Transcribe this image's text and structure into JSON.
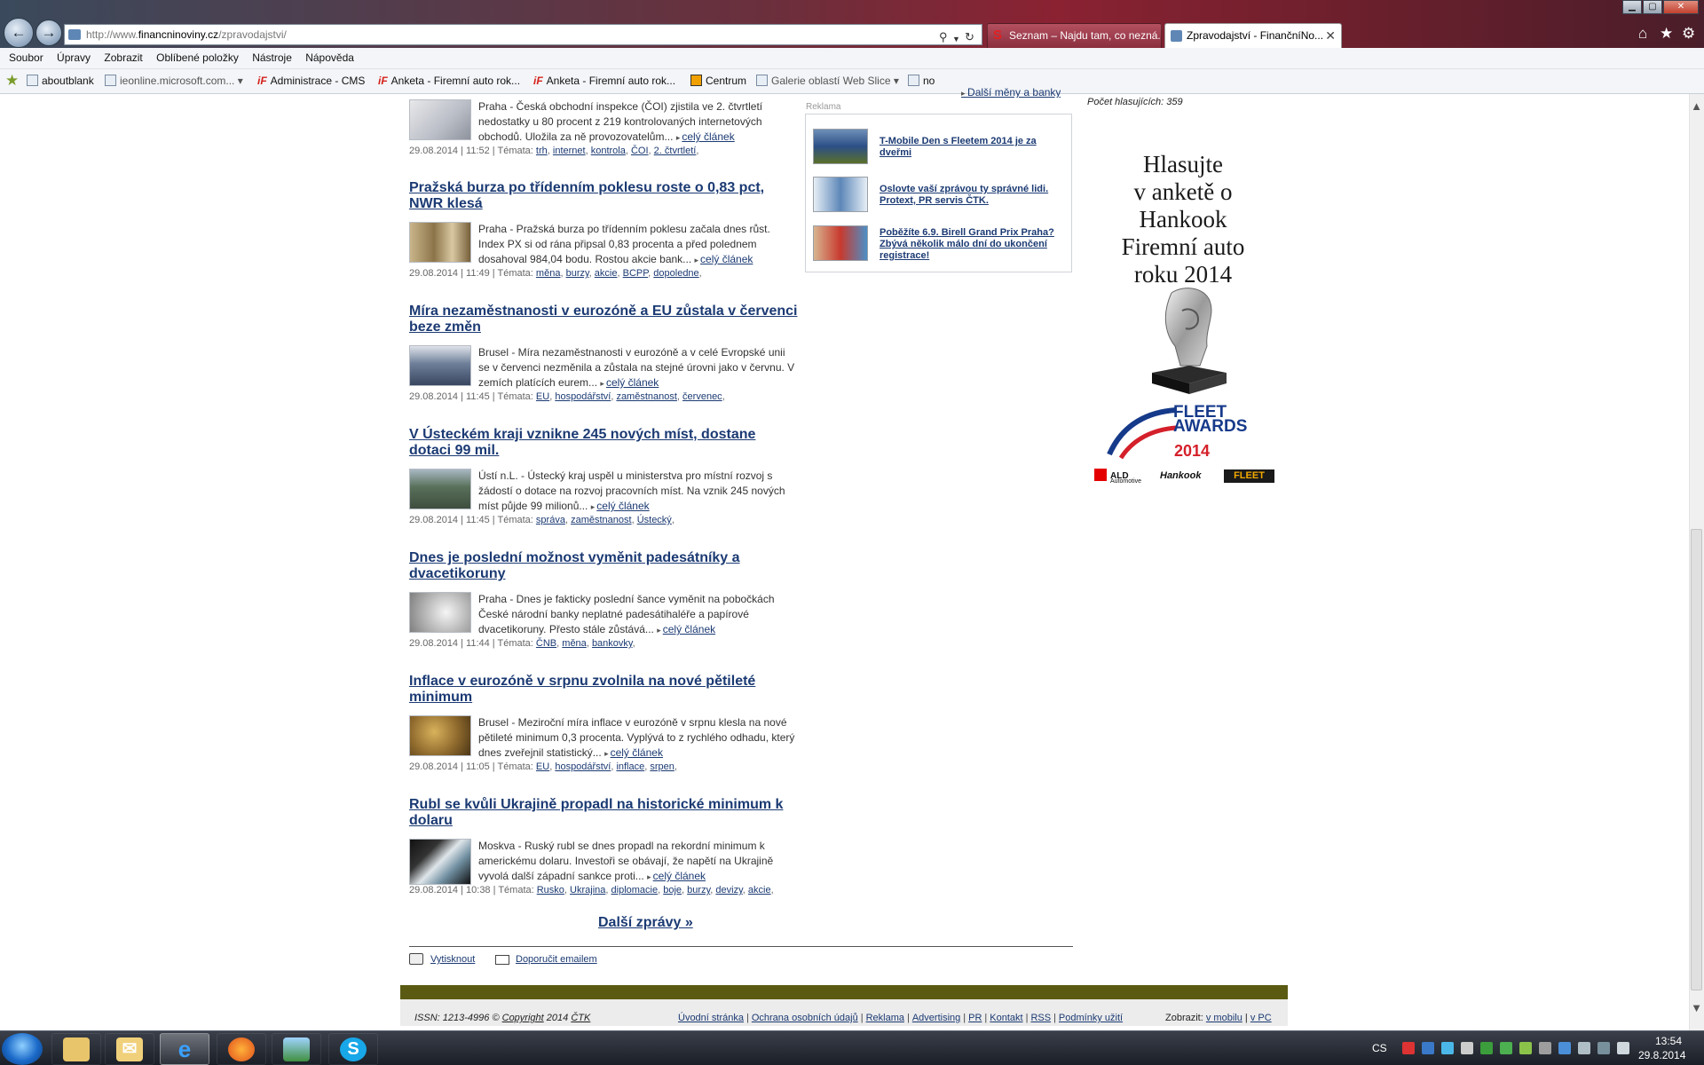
{
  "browser": {
    "address": {
      "prefix": "http://www.",
      "host": "financninoviny.cz",
      "path": "/zpravodajstvi/"
    },
    "tabs": [
      {
        "label": "Seznam – Najdu tam, co nezná...",
        "active": false
      },
      {
        "label": "Zpravodajství - FinančníNo...",
        "active": true
      }
    ],
    "menu": [
      "Soubor",
      "Úpravy",
      "Zobrazit",
      "Oblíbené položky",
      "Nástroje",
      "Nápověda"
    ],
    "favorites": [
      {
        "label": "aboutblank",
        "icon": "page-icon"
      },
      {
        "label": "ieonline.microsoft.com...",
        "icon": "page-icon"
      },
      {
        "label": "Administrace - CMS",
        "icon": "if-icon"
      },
      {
        "label": "Anketa - Firemní auto rok...",
        "icon": "if-icon"
      },
      {
        "label": "Anketa - Firemní auto rok...",
        "icon": "if-icon"
      },
      {
        "label": "Centrum",
        "icon": "centrum-icon"
      },
      {
        "label": "Galerie oblastí Web Slice",
        "icon": "page-icon"
      },
      {
        "label": "no",
        "icon": "page-icon"
      }
    ]
  },
  "articles": [
    {
      "title": "",
      "text": "Praha - Česká obchodní inspekce (ČOI) zjistila ve 2. čtvrtletí nedostatky u 80 procent z 219 kontrolovaných internetových obchodů. Uložila za ně provozovatelům...",
      "more": "celý článek",
      "meta": "29.08.2014 | 11:52 | Témata:",
      "tags": [
        "trh",
        "internet",
        "kontrola",
        "ČOI",
        "2. čtvrtletí"
      ]
    },
    {
      "title": "Pražská burza po třídenním poklesu roste o 0,83 pct, NWR klesá",
      "text": "Praha - Pražská burza po třídenním poklesu začala dnes růst. Index PX si od rána připsal 0,83 procenta a před polednem dosahoval 984,04 bodu. Rostou akcie bank...",
      "more": "celý článek",
      "meta": "29.08.2014 | 11:49 | Témata:",
      "tags": [
        "měna",
        "burzy",
        "akcie",
        "BCPP",
        "dopoledne"
      ]
    },
    {
      "title": "Míra nezaměstnanosti v eurozóně a EU zůstala v červenci beze změn",
      "text": "Brusel - Míra nezaměstnanosti v eurozóně a v celé Evropské unii se v červenci nezměnila a zůstala na stejné úrovni jako v červnu. V zemích platících eurem...",
      "more": "celý článek",
      "meta": "29.08.2014 | 11:45 | Témata:",
      "tags": [
        "EU",
        "hospodářství",
        "zaměstnanost",
        "červenec"
      ]
    },
    {
      "title": "V Ústeckém kraji vznikne 245 nových míst, dostane dotaci 99 mil.",
      "text": "Ústí n.L. - Ústecký kraj uspěl u ministerstva pro místní rozvoj s žádostí o dotace na rozvoj pracovních míst. Na vznik 245 nových míst půjde 99 milionů...",
      "more": "celý článek",
      "meta": "29.08.2014 | 11:45 | Témata:",
      "tags": [
        "správa",
        "zaměstnanost",
        "Ústecký"
      ]
    },
    {
      "title": "Dnes je poslední možnost vyměnit padesátníky a dvacetikoruny",
      "text": "Praha - Dnes je fakticky poslední šance vyměnit na pobočkách České národní banky neplatné padesátihaléře a papírové dvacetikoruny. Přesto stále zůstává...",
      "more": "celý článek",
      "meta": "29.08.2014 | 11:44 | Témata:",
      "tags": [
        "ČNB",
        "měna",
        "bankovky"
      ]
    },
    {
      "title": "Inflace v eurozóně v srpnu zvolnila na nové pětileté minimum",
      "text": "Brusel - Meziroční míra inflace v eurozóně v srpnu klesla na nové pětileté minimum 0,3 procenta. Vyplývá to z rychlého odhadu, který dnes zveřejnil statistický...",
      "more": "celý článek",
      "meta": "29.08.2014 | 11:05 | Témata:",
      "tags": [
        "EU",
        "hospodářství",
        "inflace",
        "srpen"
      ]
    },
    {
      "title": "Rubl se kvůli Ukrajině propadl na historické minimum k dolaru",
      "text": "Moskva - Ruský rubl se dnes propadl na rekordní minimum k americkému dolaru. Investoři se obávají, že napětí na Ukrajině vyvolá další západní sankce proti...",
      "more": "celý článek",
      "meta": "29.08.2014 | 10:38 | Témata:",
      "tags": [
        "Rusko",
        "Ukrajina",
        "diplomacie",
        "boje",
        "burzy",
        "devizy",
        "akcie"
      ]
    }
  ],
  "sidebar": {
    "exchange_link": "Další měny a banky",
    "ad_label": "Reklama",
    "ads": [
      "T-Mobile Den s Fleetem 2014 je za dveřmi",
      "Oslovte vaší zprávou ty správné lidi. Protext, PR servis ČTK.",
      "Poběžíte 6.9. Birell Grand Prix Praha? Zbývá několik málo dní do ukončení registrace!"
    ]
  },
  "poll": {
    "votes": "Počet hlasujících: 359",
    "banner_lines": [
      "Hlasujte",
      "v anketě o",
      "Hankook",
      "Firemní auto",
      "roku 2014"
    ],
    "fleet_word": "FLEET",
    "awards_word": "AWARDS",
    "year": "2014",
    "sponsor_ald": "ALD",
    "sponsor_ald_sub": "Automotive",
    "sponsor_hankook": "Hankook",
    "sponsor_fleet": "FLEET"
  },
  "page": {
    "more_news": "Další zprávy »",
    "print": "Vytisknout",
    "email": "Doporučit emailem"
  },
  "footer": {
    "issn_prefix": "ISSN: 1213-4996 ©",
    "copyright": "Copyright",
    "year": "2014",
    "ctk": "ČTK",
    "links": [
      "Úvodní stránka",
      "Ochrana osobních údajů",
      "Reklama",
      "Advertising",
      "PR",
      "Kontakt",
      "RSS",
      "Podmínky užití"
    ],
    "view_label": "Zobrazit:",
    "view_mobile": "v mobilu",
    "view_pc": "v PC"
  },
  "taskbar": {
    "lang": "CS",
    "time": "13:54",
    "date": "29.8.2014"
  }
}
